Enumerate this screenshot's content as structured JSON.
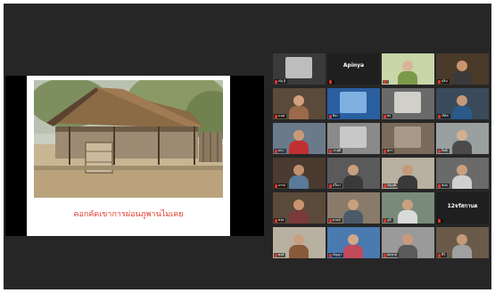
{
  "shared_slide": {
    "caption": "คอกคัดเขาการผ่อนภูพานไมเคย"
  },
  "gallery": {
    "tiles": [
      {
        "name": "ณัฐ",
        "label": "ณัฐ ฐิ",
        "bg": "#3a3a3a",
        "skin": "#c9a38a",
        "shirt": "#d9d9d9",
        "person": false,
        "screen": "#bdbdbd",
        "active": false
      },
      {
        "name": "Apinya",
        "label": "",
        "bg": "#1f1f1f",
        "skin": "",
        "shirt": "",
        "person": false,
        "screen": "",
        "active": false,
        "center": "Apinya"
      },
      {
        "name": "",
        "label": "",
        "bg": "#c8d6a8",
        "skin": "#d8b49a",
        "shirt": "#7a9a4a",
        "person": true,
        "screen": "",
        "active": true
      },
      {
        "name": "",
        "label": "ปุลิน",
        "bg": "#4a3a2a",
        "skin": "#c9956f",
        "shirt": "#3a3a3a",
        "person": true,
        "screen": "",
        "active": false
      },
      {
        "name": "",
        "label": "นนท",
        "bg": "#5a4a3a",
        "skin": "#d2a07e",
        "shirt": "#9a6a4a",
        "person": true,
        "screen": "",
        "active": false
      },
      {
        "name": "",
        "label": "ปิยะ",
        "bg": "#2a5fa0",
        "skin": "#c8a080",
        "shirt": "#e0e0e0",
        "person": false,
        "screen": "#7fb0e0",
        "active": false
      },
      {
        "name": "",
        "label": "พร",
        "bg": "#6a6a6a",
        "skin": "#cfcfcf",
        "shirt": "#8a8a8a",
        "person": false,
        "screen": "#d0d0c8",
        "active": false
      },
      {
        "name": "",
        "label": "เฟิร์ส",
        "bg": "#3a4a5a",
        "skin": "#c59a7a",
        "shirt": "#2a5a8a",
        "person": true,
        "screen": "",
        "active": false
      },
      {
        "name": "",
        "label": "ธนา",
        "bg": "#6a7a8a",
        "skin": "#c99a7a",
        "shirt": "#c03030",
        "person": true,
        "screen": "",
        "active": false
      },
      {
        "name": "",
        "label": "วรวุฒิ",
        "bg": "#8a8a8a",
        "skin": "#bdbdbd",
        "shirt": "#9a9a9a",
        "person": false,
        "screen": "#c8c8c8",
        "active": false
      },
      {
        "name": "",
        "label": "สุภา",
        "bg": "#7a6a5a",
        "skin": "#b0a090",
        "shirt": "#6a5a4a",
        "person": false,
        "screen": "#a89888",
        "active": false
      },
      {
        "name": "",
        "label": "กิตติ",
        "bg": "#9aa0a0",
        "skin": "#d0b090",
        "shirt": "#4a4a4a",
        "person": true,
        "screen": "",
        "active": false
      },
      {
        "name": "",
        "label": "อรรถ",
        "bg": "#4a3a30",
        "skin": "#c39070",
        "shirt": "#5a7a9a",
        "person": true,
        "screen": "",
        "active": false
      },
      {
        "name": "",
        "label": "ปวีณา",
        "bg": "#5a5a5a",
        "skin": "#c8a080",
        "shirt": "#3a3a3a",
        "person": true,
        "screen": "",
        "active": false
      },
      {
        "name": "",
        "label": "ณัฐวุฒิ",
        "bg": "#b8b0a0",
        "skin": "#c59a7a",
        "shirt": "#3a3a3a",
        "person": true,
        "screen": "",
        "active": false
      },
      {
        "name": "",
        "label": "ชนก",
        "bg": "#6a6a6a",
        "skin": "#c8a080",
        "shirt": "#d0d0d0",
        "person": true,
        "screen": "",
        "active": false
      },
      {
        "name": "",
        "label": "ศรุต",
        "bg": "#5a4a3a",
        "skin": "#c9956f",
        "shirt": "#7a3a3a",
        "person": true,
        "screen": "",
        "active": false
      },
      {
        "name": "",
        "label": "มายด์",
        "bg": "#8a7a6a",
        "skin": "#c8a080",
        "shirt": "#4a5a6a",
        "person": true,
        "screen": "",
        "active": false
      },
      {
        "name": "",
        "label": "ภูมิ",
        "bg": "#7a8a7a",
        "skin": "#c9a080",
        "shirt": "#dadada",
        "person": true,
        "screen": "",
        "active": false
      },
      {
        "name": "",
        "label": "",
        "bg": "#1f1f1f",
        "skin": "",
        "shirt": "",
        "person": false,
        "screen": "",
        "active": false,
        "center": "12จรัสกานต"
      },
      {
        "name": "",
        "label": "พงษ์",
        "bg": "#b8b0a0",
        "skin": "#c8a080",
        "shirt": "#8a5a3a",
        "person": true,
        "screen": "",
        "active": false
      },
      {
        "name": "",
        "label": "กัญญา",
        "bg": "#4a7ab0",
        "skin": "#d2a88a",
        "shirt": "#c04a5a",
        "person": true,
        "screen": "",
        "active": false
      },
      {
        "name": "",
        "label": "สมชาย",
        "bg": "#9a9a9a",
        "skin": "#c99a7a",
        "shirt": "#5a5a5a",
        "person": true,
        "screen": "",
        "active": false
      },
      {
        "name": "",
        "label": "ธีร์",
        "bg": "#6a5a4a",
        "skin": "#c59a7a",
        "shirt": "#a0a0a0",
        "person": true,
        "screen": "",
        "active": false
      }
    ]
  }
}
